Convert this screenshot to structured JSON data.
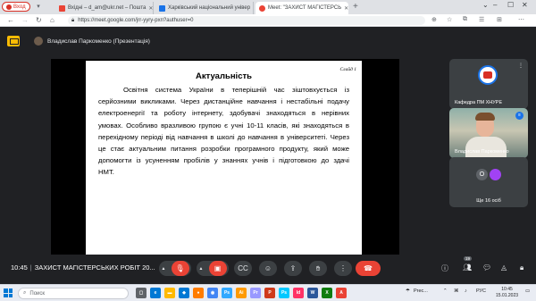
{
  "browser": {
    "profile_label": "Вход",
    "tabs": [
      {
        "title": "Вхідні – d_am@ukr.net – Пошта",
        "favicon_color": "#ea4335"
      },
      {
        "title": "Харківський національний універ",
        "favicon_color": "#1a73e8"
      },
      {
        "title": "Meet: \"ЗАХИСТ МАГІСТЕРСЬ",
        "favicon_color": "#ea4335"
      }
    ],
    "new_tab": "+",
    "url": "https://meet.google.com/jrr-yyry-pxn?authuser=0"
  },
  "presenter": {
    "label": "Владислав Паркоменко (Презентація)"
  },
  "slide": {
    "number": "Слайд 1",
    "title": "Актуальність",
    "body": "Освітня система України в теперішній час зіштовхується із серйозними викликами. Через дистанційне навчання і нестабільні подачу електроенергії та роботу інтернету, здобувачі знаходяться в нерівних умовах. Особливо вразливою групою є учні 10-11 класів, які знаходяться в перехідному періоді від навчання в школі до навчання в університеті. Через це стає актуальним питання розробки програмного продукту, який може допомогти із усуненням пробілів у знаннях учнів і підготовкою до здачі НМТ."
  },
  "participants": {
    "tile1_name": "Кафедра ПМ ХНУРЕ",
    "tile2_name": "Владислав Паркоменко",
    "more_label": "Ще 16 осіб",
    "avatar_o": "О"
  },
  "call_bar": {
    "time": "10:45",
    "separator": "|",
    "meeting_title": "ЗАХИСТ МАГІСТЕРСЬКИХ РОБІТ 20...",
    "participant_count": "19"
  },
  "taskbar": {
    "search_placeholder": "Поиск",
    "weather": "Prec...",
    "lang": "РУС",
    "time": "10:45",
    "date": "15.01.2023"
  },
  "colors": {
    "meet_bg": "#202124",
    "hangup": "#ea4335",
    "muted_btn": "#ea4335",
    "present_badge": "#fbbc04"
  }
}
